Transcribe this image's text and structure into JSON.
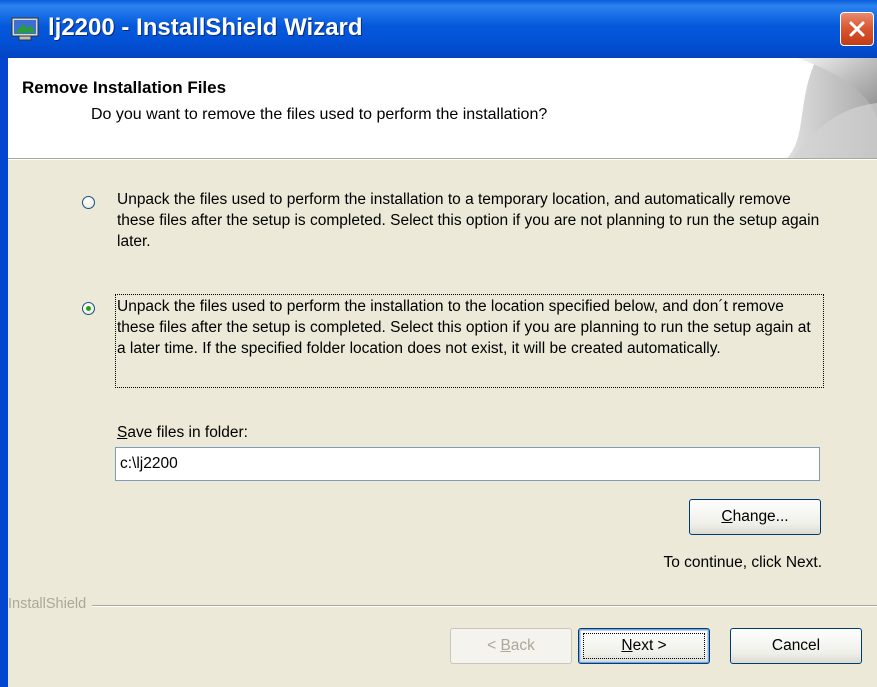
{
  "window": {
    "title": "lj2200 - InstallShield Wizard"
  },
  "header": {
    "title": "Remove Installation Files",
    "subtitle": "Do you want to remove the files used to perform the installation?"
  },
  "options": [
    {
      "text": "Unpack the files used to perform the installation to a temporary location, and automatically remove these files after the setup is completed. Select this option if you are not planning to run the setup again later.",
      "checked": false
    },
    {
      "text": "Unpack the files used to perform the installation to the location specified below, and don´t remove these files after the setup is completed. Select this option if you are planning to run the setup again at a later time. If the specified folder location does not exist, it will be created automatically.",
      "checked": true
    }
  ],
  "folder": {
    "label_first": "S",
    "label_rest": "ave files in folder:",
    "value": "c:\\lj2200"
  },
  "buttons": {
    "change_first": "C",
    "change_rest": "hange...",
    "back_pre": "< ",
    "back_first": "B",
    "back_rest": "ack",
    "next_first": "N",
    "next_rest": "ext >",
    "cancel": "Cancel"
  },
  "continue_hint": "To continue, click Next.",
  "brand": "InstallShield",
  "colors": {
    "titlebar": "#0458dc",
    "dialog_bg": "#ece9d8",
    "close_button": "#d8552f"
  }
}
